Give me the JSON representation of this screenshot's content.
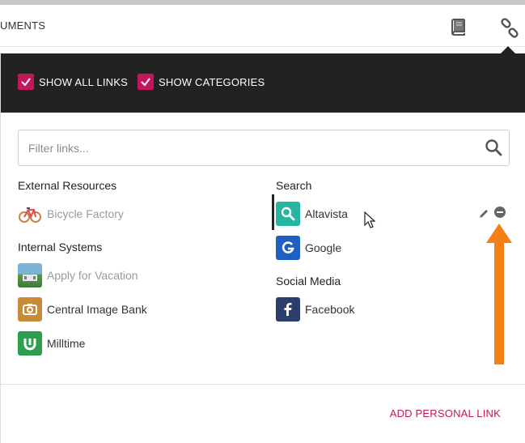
{
  "header": {
    "breadcrumb": "UMENTS",
    "icons": [
      "book-icon",
      "link-icon"
    ]
  },
  "panel": {
    "options": {
      "show_all_links": {
        "label": "SHOW ALL LINKS",
        "checked": true
      },
      "show_categories": {
        "label": "SHOW CATEGORIES",
        "checked": true
      }
    },
    "filter": {
      "placeholder": "Filter links...",
      "value": ""
    },
    "left_column": [
      {
        "category": "External Resources",
        "links": [
          {
            "label": "Bicycle Factory",
            "icon": "bicycle-icon",
            "dimmed": true
          }
        ]
      },
      {
        "category": "Internal Systems",
        "links": [
          {
            "label": "Apply for Vacation",
            "icon": "vacation-photo-icon",
            "dimmed": true
          },
          {
            "label": "Central Image Bank",
            "icon": "camera-icon",
            "dimmed": false
          },
          {
            "label": "Milltime",
            "icon": "milltime-icon",
            "dimmed": false
          }
        ]
      }
    ],
    "right_column": [
      {
        "category": "Search",
        "links": [
          {
            "label": "Altavista",
            "icon": "search-icon",
            "selected": true
          },
          {
            "label": "Google",
            "icon": "google-icon",
            "selected": false
          }
        ]
      },
      {
        "category": "Social Media",
        "links": [
          {
            "label": "Facebook",
            "icon": "facebook-icon",
            "selected": false
          }
        ]
      }
    ],
    "footer": {
      "add_personal_link": "ADD PERSONAL LINK"
    }
  },
  "colors": {
    "accent": "#c2185b",
    "panel_header": "#222222",
    "annotation_arrow": "#f57f17",
    "altavista_icon": "#26b5a0",
    "google_icon": "#1f5fbf",
    "facebook_icon": "#2c3e6b",
    "camera_icon": "#c98a3a",
    "milltime_icon": "#2e9e4f"
  }
}
